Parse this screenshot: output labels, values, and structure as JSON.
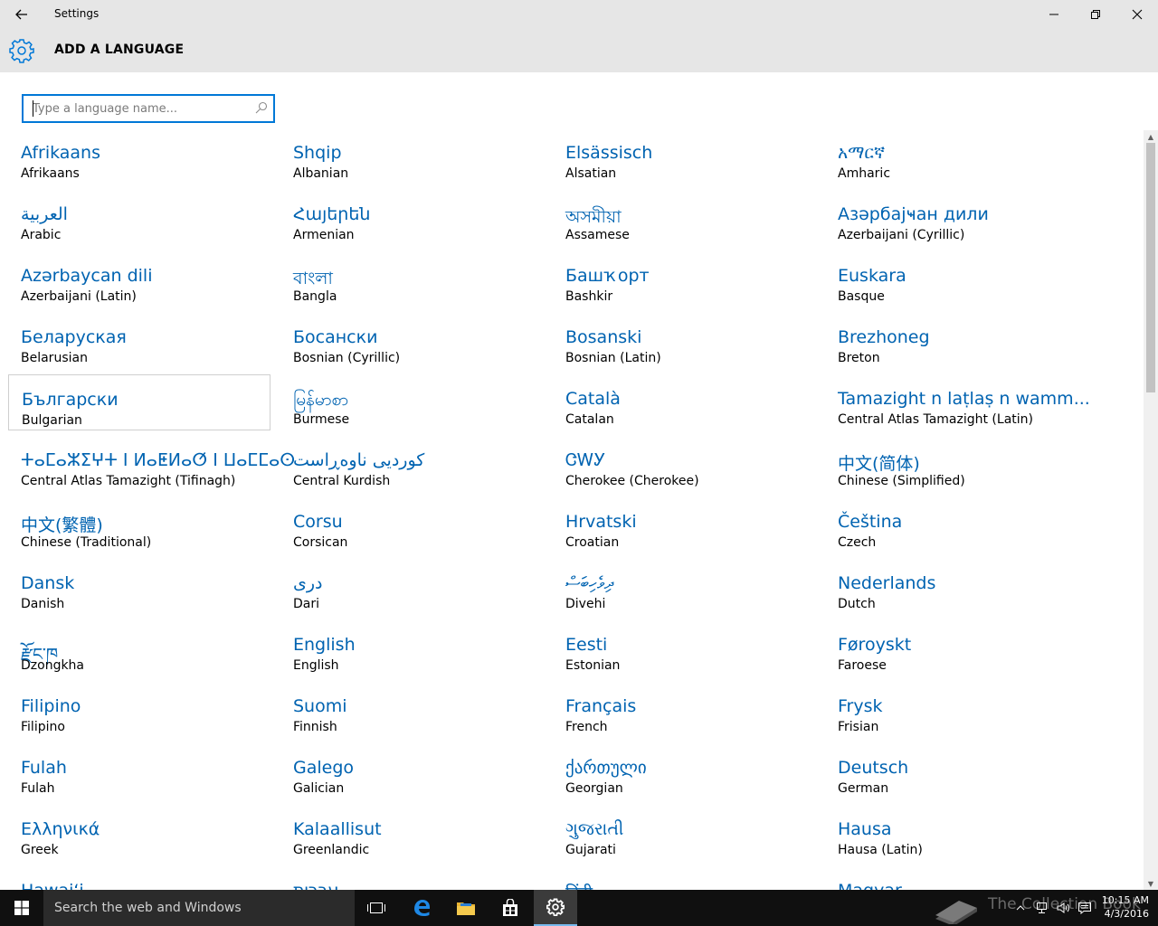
{
  "window": {
    "title": "Settings"
  },
  "header": {
    "page_title": "ADD A LANGUAGE"
  },
  "search": {
    "placeholder": "Type a language name..."
  },
  "languages": [
    {
      "native": "Afrikaans",
      "english": "Afrikaans"
    },
    {
      "native": "Shqip",
      "english": "Albanian"
    },
    {
      "native": "Elsässisch",
      "english": "Alsatian"
    },
    {
      "native": "አማርኛ",
      "english": "Amharic"
    },
    {
      "native": "العربية",
      "english": "Arabic"
    },
    {
      "native": "Հայերեն",
      "english": "Armenian"
    },
    {
      "native": "অসমীয়া",
      "english": "Assamese"
    },
    {
      "native": "Азәрбајҹан дили",
      "english": "Azerbaijani (Cyrillic)"
    },
    {
      "native": "Azərbaycan dili",
      "english": "Azerbaijani (Latin)"
    },
    {
      "native": "বাংলা",
      "english": "Bangla"
    },
    {
      "native": "Башҡорт",
      "english": "Bashkir"
    },
    {
      "native": "Euskara",
      "english": "Basque"
    },
    {
      "native": "Беларуская",
      "english": "Belarusian"
    },
    {
      "native": "Босански",
      "english": "Bosnian (Cyrillic)"
    },
    {
      "native": "Bosanski",
      "english": "Bosnian (Latin)"
    },
    {
      "native": "Brezhoneg",
      "english": "Breton"
    },
    {
      "native": "Български",
      "english": "Bulgarian"
    },
    {
      "native": "မြန်မာစာ",
      "english": "Burmese"
    },
    {
      "native": "Català",
      "english": "Catalan"
    },
    {
      "native": "Tamazight n laṭlaṣ n wamm...",
      "english": "Central Atlas Tamazight (Latin)"
    },
    {
      "native": "ⵜⴰⵎⴰⵣⵉⵖⵜ ⵏ ⵍⴰⵟⵍⴰⵚ ⵏ ⵡⴰⵎⵎⴰⵙ",
      "english": "Central Atlas Tamazight (Tifinagh)"
    },
    {
      "native": "کوردیی ناوەڕاست",
      "english": "Central Kurdish"
    },
    {
      "native": "ᏣᎳᎩ",
      "english": "Cherokee (Cherokee)"
    },
    {
      "native": "中文(简体)",
      "english": "Chinese (Simplified)"
    },
    {
      "native": "中文(繁體)",
      "english": "Chinese (Traditional)"
    },
    {
      "native": "Corsu",
      "english": "Corsican"
    },
    {
      "native": "Hrvatski",
      "english": "Croatian"
    },
    {
      "native": "Čeština",
      "english": "Czech"
    },
    {
      "native": "Dansk",
      "english": "Danish"
    },
    {
      "native": "درى",
      "english": "Dari"
    },
    {
      "native": "ދިވެހިބަސް",
      "english": "Divehi"
    },
    {
      "native": "Nederlands",
      "english": "Dutch"
    },
    {
      "native": "རྫོང་ཁ",
      "english": "Dzongkha"
    },
    {
      "native": "English",
      "english": "English"
    },
    {
      "native": "Eesti",
      "english": "Estonian"
    },
    {
      "native": "Føroyskt",
      "english": "Faroese"
    },
    {
      "native": "Filipino",
      "english": "Filipino"
    },
    {
      "native": "Suomi",
      "english": "Finnish"
    },
    {
      "native": "Français",
      "english": "French"
    },
    {
      "native": "Frysk",
      "english": "Frisian"
    },
    {
      "native": "Fulah",
      "english": "Fulah"
    },
    {
      "native": "Galego",
      "english": "Galician"
    },
    {
      "native": "ქართული",
      "english": "Georgian"
    },
    {
      "native": "Deutsch",
      "english": "German"
    },
    {
      "native": "Ελληνικά",
      "english": "Greek"
    },
    {
      "native": "Kalaallisut",
      "english": "Greenlandic"
    },
    {
      "native": "ગુજરાતી",
      "english": "Gujarati"
    },
    {
      "native": "Hausa",
      "english": "Hausa (Latin)"
    },
    {
      "native": "Hawaiʻi",
      "english": ""
    },
    {
      "native": "עברית",
      "english": ""
    },
    {
      "native": "हिंदी",
      "english": ""
    },
    {
      "native": "Magyar",
      "english": ""
    }
  ],
  "taskbar": {
    "search_placeholder": "Search the web and Windows",
    "watermark": "The Collection Book"
  },
  "clock": {
    "time": "10:15 AM",
    "date": "4/3/2016"
  },
  "colors": {
    "accent": "#0078d7",
    "link": "#0063b1",
    "header_bg": "#e6e6e6",
    "taskbar_bg": "#101010"
  }
}
